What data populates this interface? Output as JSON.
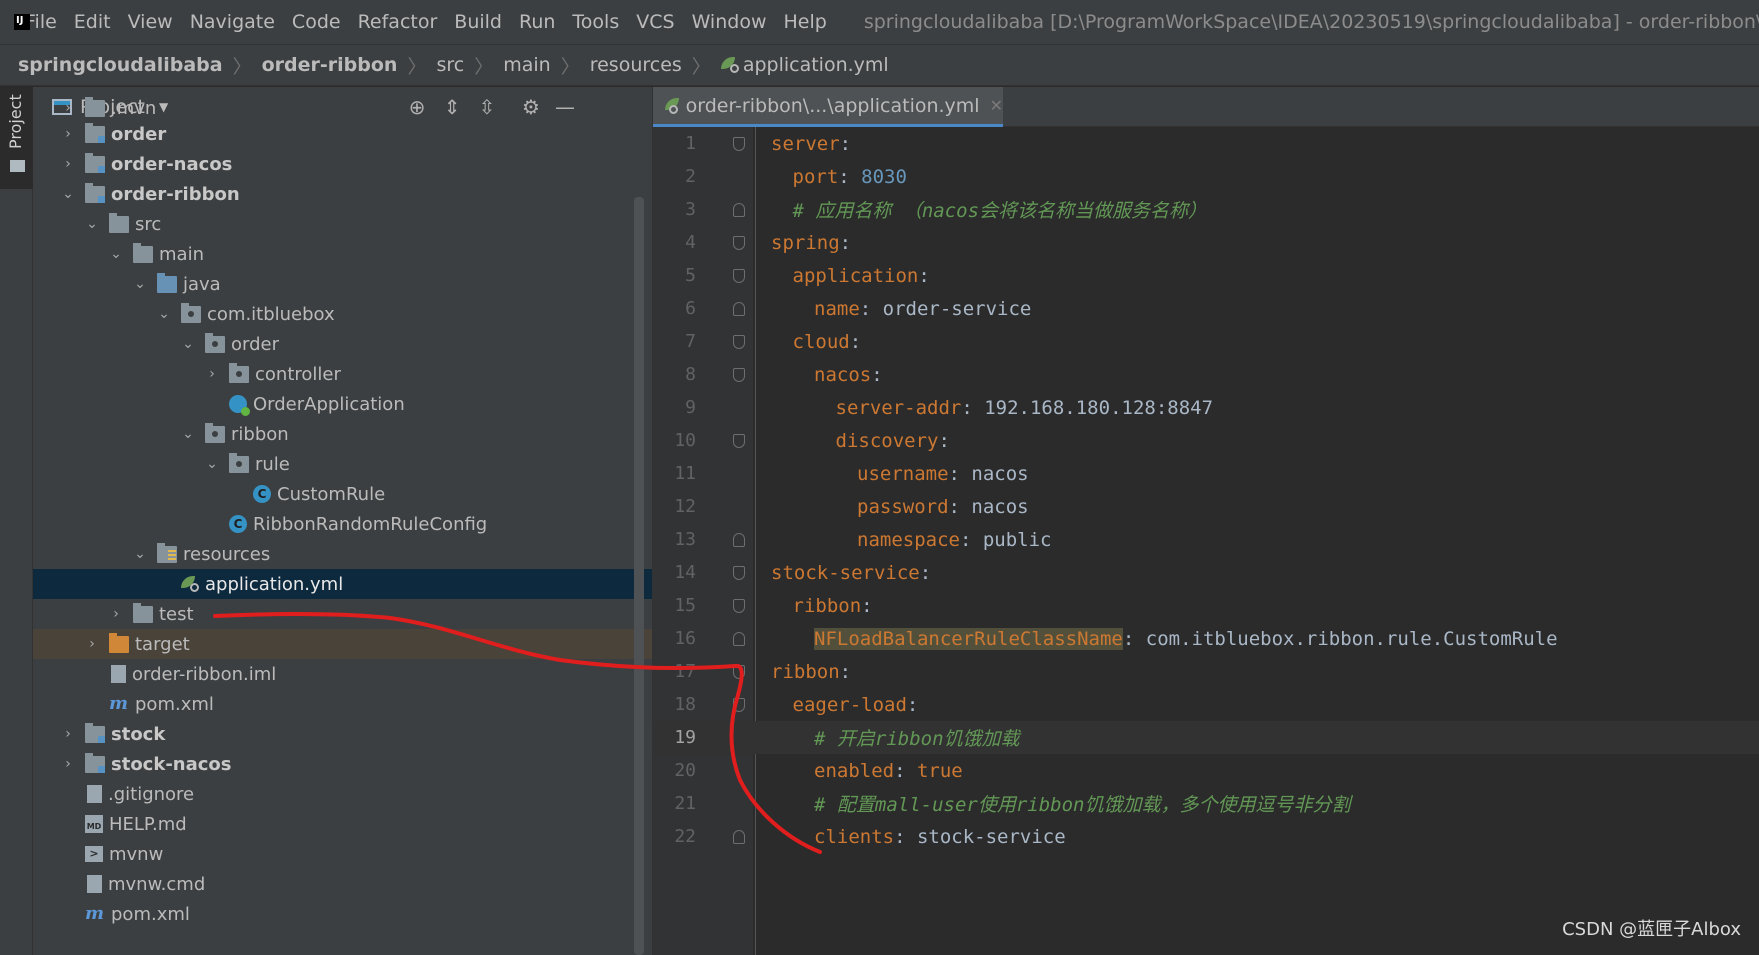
{
  "menubar": {
    "items": [
      "File",
      "Edit",
      "View",
      "Navigate",
      "Code",
      "Refactor",
      "Build",
      "Run",
      "Tools",
      "VCS",
      "Window",
      "Help"
    ],
    "window_title": "springcloudalibaba [D:\\ProgramWorkSpace\\IDEA\\20230519\\springcloudalibaba] - order-ribbon\\...\\app"
  },
  "breadcrumb": [
    "springcloudalibaba",
    "order-ribbon",
    "src",
    "main",
    "resources",
    "application.yml"
  ],
  "tool_strip": {
    "project_label": "Project"
  },
  "project_panel": {
    "title": "Project",
    "tree": [
      {
        "label": ".mvn"
      },
      {
        "label": "order"
      },
      {
        "label": "order-nacos"
      },
      {
        "label": "order-ribbon"
      },
      {
        "label": "src"
      },
      {
        "label": "main"
      },
      {
        "label": "java"
      },
      {
        "label": "com.itbluebox"
      },
      {
        "label": "order"
      },
      {
        "label": "controller"
      },
      {
        "label": "OrderApplication"
      },
      {
        "label": "ribbon"
      },
      {
        "label": "rule"
      },
      {
        "label": "CustomRule"
      },
      {
        "label": "RibbonRandomRuleConfig"
      },
      {
        "label": "resources"
      },
      {
        "label": "application.yml"
      },
      {
        "label": "test"
      },
      {
        "label": "target"
      },
      {
        "label": "order-ribbon.iml"
      },
      {
        "label": "pom.xml"
      },
      {
        "label": "stock"
      },
      {
        "label": "stock-nacos"
      },
      {
        "label": ".gitignore"
      },
      {
        "label": "HELP.md"
      },
      {
        "label": "mvnw"
      },
      {
        "label": "mvnw.cmd"
      },
      {
        "label": "pom.xml"
      }
    ]
  },
  "editor": {
    "tab_label": "order-ribbon\\...\\application.yml",
    "current_line": 19,
    "lines": [
      {
        "num": "1",
        "key": "server",
        "sep": ":",
        "val": ""
      },
      {
        "num": "2",
        "key": "port",
        "sep": ": ",
        "val": "8030"
      },
      {
        "num": "3",
        "comment": "# 应用名称 （nacos会将该名称当做服务名称）"
      },
      {
        "num": "4",
        "key": "spring",
        "sep": ":",
        "val": ""
      },
      {
        "num": "5",
        "key": "application",
        "sep": ":",
        "val": ""
      },
      {
        "num": "6",
        "key": "name",
        "sep": ": ",
        "val": "order-service"
      },
      {
        "num": "7",
        "key": "cloud",
        "sep": ":",
        "val": ""
      },
      {
        "num": "8",
        "key": "nacos",
        "sep": ":",
        "val": ""
      },
      {
        "num": "9",
        "key": "server-addr",
        "sep": ": ",
        "val": "192.168.180.128:8847"
      },
      {
        "num": "10",
        "key": "discovery",
        "sep": ":",
        "val": ""
      },
      {
        "num": "11",
        "key": "username",
        "sep": ": ",
        "val": "nacos"
      },
      {
        "num": "12",
        "key": "password",
        "sep": ": ",
        "val": "nacos"
      },
      {
        "num": "13",
        "key": "namespace",
        "sep": ": ",
        "val": "public"
      },
      {
        "num": "14",
        "key": "stock-service",
        "sep": ":",
        "val": ""
      },
      {
        "num": "15",
        "key": "ribbon",
        "sep": ":",
        "val": ""
      },
      {
        "num": "16",
        "key": "NFLoadBalancerRuleClassName",
        "sep": ": ",
        "val": "com.itbluebox.ribbon.rule.CustomRule"
      },
      {
        "num": "17",
        "key": "ribbon",
        "sep": ":",
        "val": ""
      },
      {
        "num": "18",
        "key": "eager-load",
        "sep": ":",
        "val": ""
      },
      {
        "num": "19",
        "comment": "# 开启ribbon饥饿加载"
      },
      {
        "num": "20",
        "key": "enabled",
        "sep": ": ",
        "val": "true"
      },
      {
        "num": "21",
        "comment": "# 配置mall-user使用ribbon饥饿加载，多个使用逗号非分割"
      },
      {
        "num": "22",
        "key": "clients",
        "sep": ": ",
        "val": "stock-service"
      }
    ]
  },
  "watermark": "CSDN @蓝匣子Albox",
  "colors": {
    "background": "#2b2b2b",
    "panel": "#3c3f41",
    "selection": "#0d293e",
    "yaml_key": "#cc7832",
    "yaml_value": "#a9b7c6",
    "number": "#6897bb",
    "comment": "#629755",
    "annotation": "#e01e1e"
  },
  "icons": [
    "intellij-logo",
    "yaml-file-icon",
    "project-view-icon",
    "locate-icon",
    "expand-all-icon",
    "collapse-all-icon",
    "gear-icon",
    "minimize-icon",
    "folder-icon",
    "class-icon",
    "spring-boot-app-icon",
    "maven-icon"
  ]
}
